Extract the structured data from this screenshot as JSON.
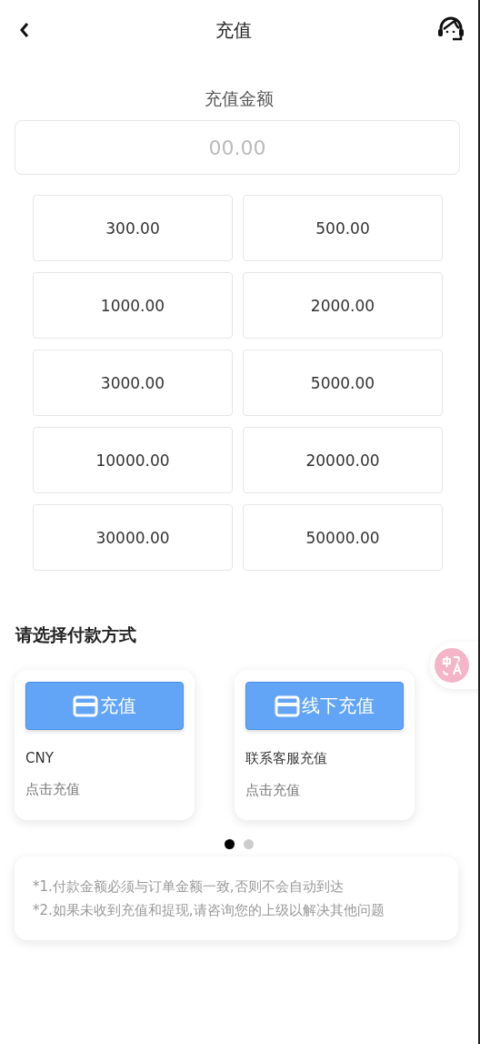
{
  "header": {
    "title": "充值"
  },
  "amount": {
    "label": "充值金额",
    "placeholder": "00.00"
  },
  "presets": [
    "300.00",
    "500.00",
    "1000.00",
    "2000.00",
    "3000.00",
    "5000.00",
    "10000.00",
    "20000.00",
    "30000.00",
    "50000.00"
  ],
  "payment": {
    "title": "请选择付款方式",
    "methods": [
      {
        "button": "充值",
        "name": "CNY",
        "hint": "点击充值"
      },
      {
        "button": "线下充值",
        "name": "联系客服充值",
        "hint": "点击充值"
      }
    ],
    "pages": [
      {
        "selected": true
      },
      {
        "selected": false
      }
    ]
  },
  "notes": [
    "*1.付款金额必须与订单金额一致,否则不会自动到达",
    "*2.如果未收到充值和提现,请咨询您的上级以解决其他问题"
  ]
}
